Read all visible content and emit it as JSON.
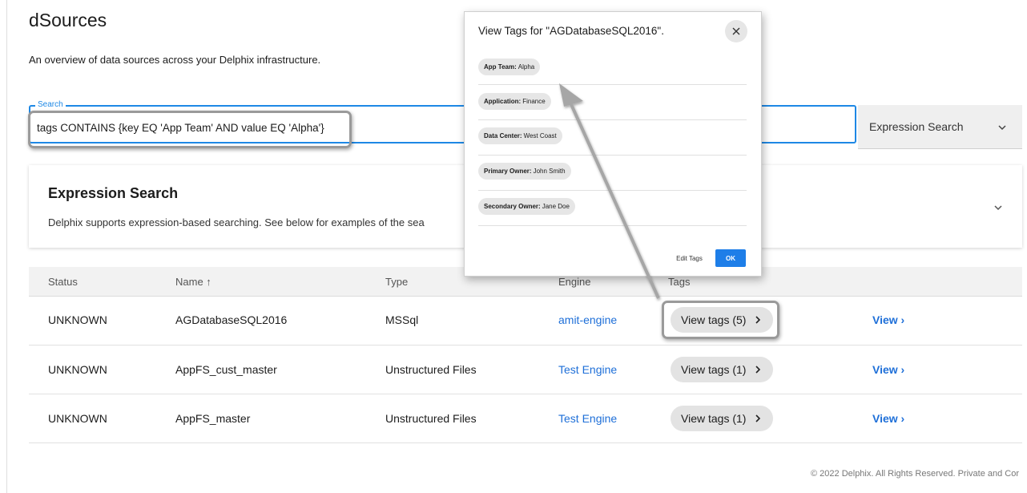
{
  "page": {
    "title": "dSources",
    "subtitle": "An overview of data sources across your Delphix infrastructure."
  },
  "search": {
    "label": "Search",
    "value": "tags CONTAINS {key EQ 'App Team' AND value EQ 'Alpha'}",
    "mode_label": "Expression Search",
    "mode_icon": "chevron-down-icon"
  },
  "expression_panel": {
    "title": "Expression Search",
    "description": "Delphix supports expression-based searching. See below for examples of the sea"
  },
  "table": {
    "headers": {
      "status": "Status",
      "name": "Name ↑",
      "type": "Type",
      "engine": "Engine",
      "tags": "Tags"
    },
    "rows": [
      {
        "status": "UNKNOWN",
        "name": "AGDatabaseSQL2016",
        "type": "MSSql",
        "engine": "amit-engine",
        "tags": "View tags (5)",
        "action": "View"
      },
      {
        "status": "UNKNOWN",
        "name": "AppFS_cust_master",
        "type": "Unstructured Files",
        "engine": "Test Engine",
        "tags": "View tags (1)",
        "action": "View"
      },
      {
        "status": "UNKNOWN",
        "name": "AppFS_master",
        "type": "Unstructured Files",
        "engine": "Test Engine",
        "tags": "View tags (1)",
        "action": "View"
      }
    ]
  },
  "footer": "© 2022 Delphix. All Rights Reserved. Private and Cor",
  "modal": {
    "title": "View Tags for \"AGDatabaseSQL2016\".",
    "tags": [
      {
        "key": "App Team:",
        "value": "Alpha"
      },
      {
        "key": "Application:",
        "value": "Finance"
      },
      {
        "key": "Data Center:",
        "value": "West Coast"
      },
      {
        "key": "Primary Owner:",
        "value": "John Smith"
      },
      {
        "key": "Secondary Owner:",
        "value": "Jane Doe"
      }
    ],
    "edit_label": "Edit Tags",
    "ok_label": "OK"
  },
  "colors": {
    "accent": "#1e88e5",
    "link": "#1e6fd8",
    "primary_button": "#1e7ee8",
    "annotation_gray": "#9a9a9a"
  }
}
